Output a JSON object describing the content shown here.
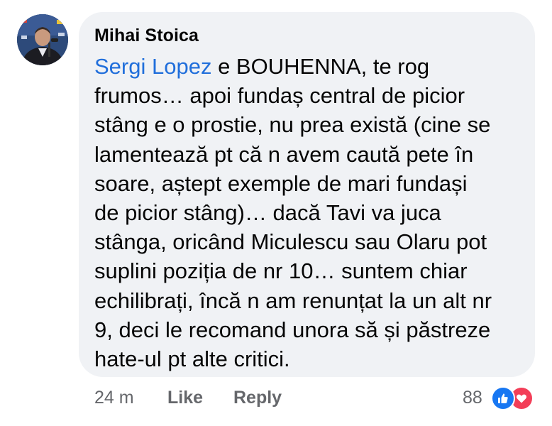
{
  "comment": {
    "author": "Mihai Stoica",
    "mention": "Sergi Lopez",
    "lines": [
      " e BOUHENNA, te rog",
      "frumos… apoi fundaș central de picior",
      "stâng e o prostie, nu prea există (cine se",
      "lamentează pt că n avem caută pete în",
      "soare, aștept exemple de mari fundași",
      "de picior stâng)… dacă Tavi va juca",
      "stânga, oricând Miculescu sau Olaru pot",
      "suplini poziția de nr 10…  suntem chiar",
      "echilibrați, încă n am renunțat la un alt nr",
      "9, deci le recomand unora să și păstreze",
      "hate-ul pt alte critici."
    ]
  },
  "actions": {
    "time": "24 m",
    "like": "Like",
    "reply": "Reply"
  },
  "reactions": {
    "count": "88",
    "icons": [
      "like-icon",
      "love-icon"
    ],
    "colors": {
      "like": "#1877f2",
      "love": "#f33e58"
    }
  },
  "colors": {
    "bubble": "#f0f2f5",
    "mention": "#216fdb",
    "meta_text": "#65676b",
    "body_text": "#050505"
  }
}
